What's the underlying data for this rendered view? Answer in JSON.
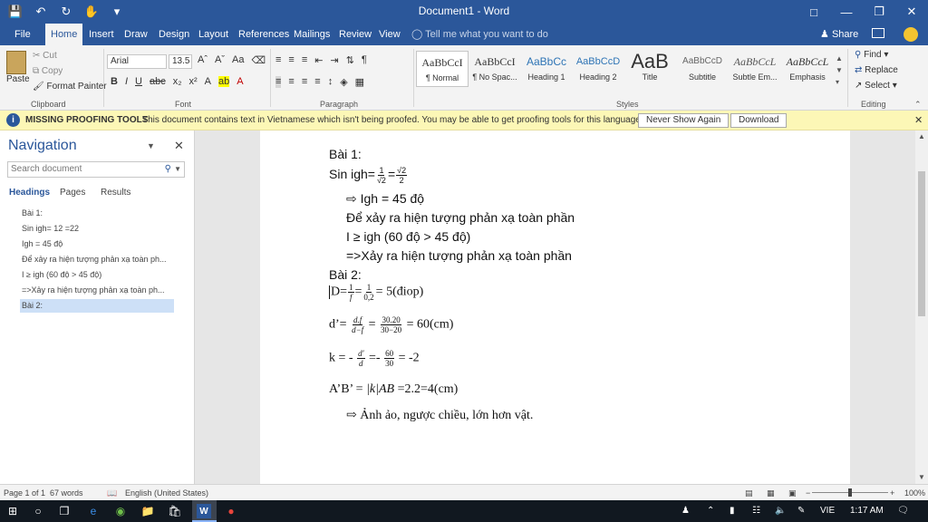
{
  "window": {
    "title": "Document1 - Word",
    "accent": "#2b579a"
  },
  "tabs": {
    "items": [
      "File",
      "Home",
      "Insert",
      "Draw",
      "Design",
      "Layout",
      "References",
      "Mailings",
      "Review",
      "View"
    ],
    "active": "Home",
    "tell_me": "Tell me what you want to do",
    "share": "Share"
  },
  "ribbon": {
    "clipboard": {
      "paste": "Paste",
      "cut": "Cut",
      "copy": "Copy",
      "format_painter": "Format Painter",
      "label": "Clipboard"
    },
    "font": {
      "name": "Arial",
      "size": "13.5",
      "label": "Font"
    },
    "paragraph_label": "Paragraph",
    "styles": [
      {
        "sample": "AaBbCcI",
        "name": "¶ Normal"
      },
      {
        "sample": "AaBbCcI",
        "name": "¶ No Spac..."
      },
      {
        "sample": "AaBbCc",
        "name": "Heading 1"
      },
      {
        "sample": "AaBbCcD",
        "name": "Heading 2"
      },
      {
        "sample": "AaB",
        "name": "Title"
      },
      {
        "sample": "AaBbCcD",
        "name": "Subtitle"
      },
      {
        "sample": "AaBbCcL",
        "name": "Subtle Em..."
      },
      {
        "sample": "AaBbCcL",
        "name": "Emphasis"
      }
    ],
    "styles_label": "Styles",
    "editing": {
      "find": "Find",
      "replace": "Replace",
      "select": "Select",
      "label": "Editing"
    }
  },
  "message_bar": {
    "title": "MISSING PROOFING TOOLS",
    "text": "This document contains text in Vietnamese which isn't being proofed. You may be able to get proofing tools for this language.",
    "never_show": "Never Show Again",
    "download": "Download"
  },
  "navigation": {
    "title": "Navigation",
    "search_placeholder": "Search document",
    "tabs": [
      "Headings",
      "Pages",
      "Results"
    ],
    "headings": [
      "Bài 1:",
      "Sin igh= 12 =22",
      "Igh = 45 độ",
      "Để xảy ra hiện tượng phản xạ toàn ph...",
      "I ≥ igh (60 độ > 45 độ)",
      "=>Xảy ra hiện tượng phản xạ toàn ph...",
      "Bài 2:"
    ],
    "selected_index": 6
  },
  "document": {
    "bai1": "Bài 1:",
    "sin_prefix": "Sin igh=",
    "frac1_num": "1",
    "frac1_den": "√2",
    "eq": "=",
    "frac2_num": "√2",
    "frac2_den": "2",
    "igh": "Igh = 45 độ",
    "de_xay_ra": "Để xảy ra hiện tượng phản xạ toàn phần",
    "i_ge": "I ≥ igh (60 độ > 45 độ)",
    "xay_ra": "=>Xảy ra hiện tượng phản xạ toàn phần",
    "bai2": "Bài 2:",
    "d_prefix": "D=",
    "d_f1_num": "1",
    "d_f1_den": "f",
    "d_f2_num": "1",
    "d_f2_den": "0,2",
    "d_result": "= 5(điop)",
    "dp_prefix": "d’=",
    "dp_f1_num": "d.f",
    "dp_f1_den": "d−f",
    "dp_f2_num": "30.20",
    "dp_f2_den": "30−20",
    "dp_result": "= 60(cm)",
    "k_prefix": "k = -",
    "k_f1_num": "d′",
    "k_f1_den": "d",
    "k_mid": "=-",
    "k_f2_num": "60",
    "k_f2_den": "30",
    "k_result": "= -2",
    "ab_prefix": "A’B’ =",
    "ab_abs": "|k|",
    "ab_var": "AB",
    "ab_result": "=2.2=4(cm)",
    "conclusion": "Ảnh ảo, ngược chiều, lớn hơn vật."
  },
  "status_bar": {
    "page": "Page 1 of 1",
    "words": "67 words",
    "language": "English (United States)",
    "zoom": "100%"
  },
  "taskbar": {
    "lang": "VIE",
    "time": "1:17 AM"
  }
}
